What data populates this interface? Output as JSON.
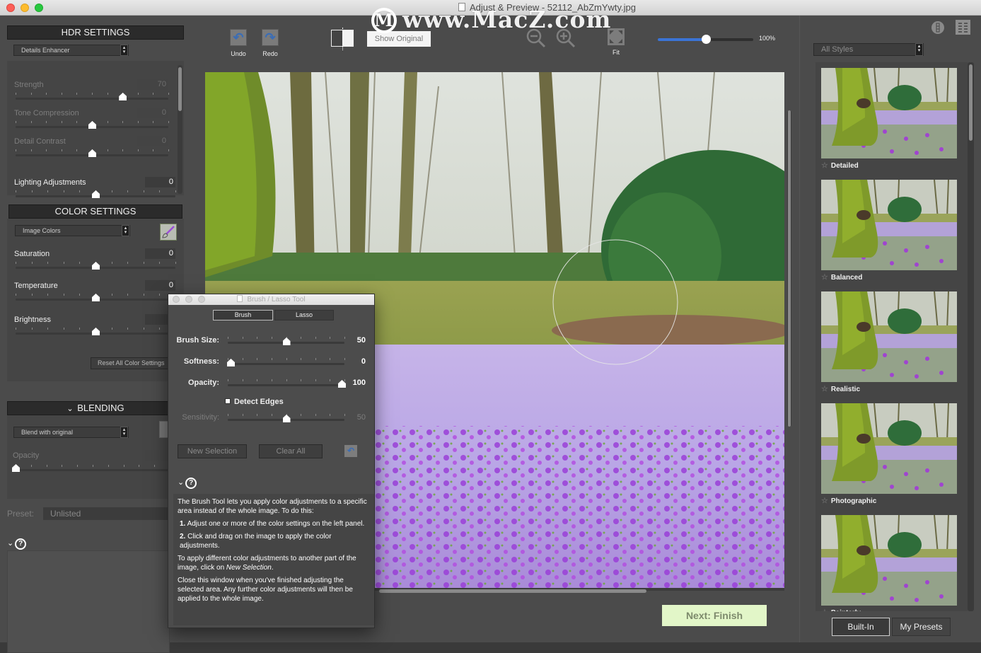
{
  "window": {
    "title": "Adjust & Preview - 52112_AbZmYwty.jpg",
    "watermark": "www.MacZ.com",
    "watermark_logo": "M"
  },
  "left_panel": {
    "hdr": {
      "title": "HDR SETTINGS",
      "preset_select": "Details Enhancer",
      "sliders": [
        {
          "label": "Strength",
          "value": "70",
          "position": 0.7,
          "enabled": false
        },
        {
          "label": "Tone Compression",
          "value": "0",
          "position": 0.5,
          "enabled": false
        },
        {
          "label": "Detail Contrast",
          "value": "0",
          "position": 0.5,
          "enabled": false
        },
        {
          "label": "Lighting Adjustments",
          "value": "0",
          "position": 0.5,
          "enabled": true
        }
      ]
    },
    "color": {
      "title": "COLOR SETTINGS",
      "select": "Image Colors",
      "sliders": [
        {
          "label": "Saturation",
          "value": "0",
          "position": 0.5
        },
        {
          "label": "Temperature",
          "value": "0",
          "position": 0.5
        },
        {
          "label": "Brightness",
          "value": "",
          "position": 0.5
        }
      ],
      "reset_label": "Reset All Color Settings"
    },
    "blending": {
      "title": "BLENDING",
      "select": "Blend with original",
      "opacity_label": "Opacity",
      "opacity_position": 0.0
    },
    "preset_label": "Preset:",
    "preset_value": "Unlisted"
  },
  "toolbar": {
    "undo": "Undo",
    "redo": "Redo",
    "show_original": "Show Original",
    "fit": "Fit",
    "zoom_percent": "100%",
    "zoom_fraction": 0.5
  },
  "next_button": "Next: Finish",
  "right_panel": {
    "filter_select": "All Styles",
    "styles": [
      {
        "name": "Detailed"
      },
      {
        "name": "Balanced"
      },
      {
        "name": "Realistic"
      },
      {
        "name": "Photographic"
      },
      {
        "name": "Painterly"
      }
    ],
    "tabs": [
      "Built-In",
      "My Presets"
    ],
    "active_tab": "Built-In"
  },
  "brush_dialog": {
    "title": "Brush / Lasso Tool",
    "modes": [
      "Brush",
      "Lasso"
    ],
    "active_mode": "Brush",
    "sliders": [
      {
        "label": "Brush Size:",
        "value": "50",
        "position": 0.5,
        "enabled": true
      },
      {
        "label": "Softness:",
        "value": "0",
        "position": 0.0,
        "enabled": true
      },
      {
        "label": "Opacity:",
        "value": "100",
        "position": 1.0,
        "enabled": true
      },
      {
        "label": "Sensitivity:",
        "value": "50",
        "position": 0.5,
        "enabled": false
      }
    ],
    "detect_edges_label": "Detect Edges",
    "detect_edges_checked": false,
    "new_selection": "New Selection",
    "clear_all": "Clear All",
    "help": {
      "intro": "The Brush Tool lets you apply color adjustments to a specific area instead of the whole image. To do this:",
      "step1_num": "1.",
      "step1": " Adjust one or more of the color settings on the left panel.",
      "step2_num": "2.",
      "step2": " Click and drag on the image to apply the color adjustments.",
      "para2_a": "To apply different color adjustments to another part of the image, click on ",
      "para2_em": "New Selection",
      "para2_b": ".",
      "para3": "Close this window when you've finished adjusting the selected area. Any further color adjustments will then be applied to the whole image."
    }
  }
}
